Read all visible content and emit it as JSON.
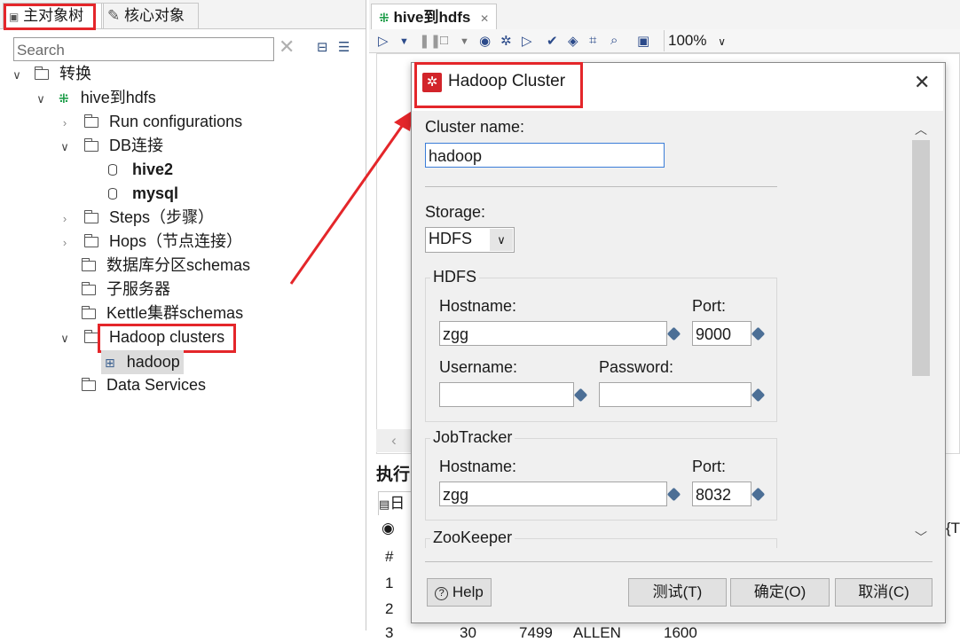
{
  "left_panel": {
    "tabs": [
      {
        "label": "主对象树"
      },
      {
        "label": "核心对象"
      }
    ],
    "search_placeholder": "Search",
    "tree": {
      "root": "转换",
      "transform": "hive到hdfs",
      "run_configs": "Run configurations",
      "db_conn": "DB连接",
      "db_hive2": "hive2",
      "db_mysql": "mysql",
      "steps": "Steps（步骤）",
      "hops": "Hops（节点连接）",
      "partition": "数据库分区schemas",
      "slaves": "子服务器",
      "kettle_cluster": "Kettle集群schemas",
      "hadoop_clusters": "Hadoop clusters",
      "hadoop": "hadoop",
      "data_services": "Data Services"
    }
  },
  "editor": {
    "tab_label": "hive到hdfs",
    "zoom": "100%",
    "bottom_heading": "执行",
    "log_tab": "日",
    "table_header": "#",
    "rows": [
      "1",
      "2",
      "3"
    ],
    "row3_cells": [
      "30",
      "7499",
      "ALLEN",
      "1600"
    ],
    "right_edge": "{T"
  },
  "dialog": {
    "title": "Hadoop Cluster",
    "cluster_name_label": "Cluster name:",
    "cluster_name_value": "hadoop",
    "storage_label": "Storage:",
    "storage_value": "HDFS",
    "hdfs_group": "HDFS",
    "hdfs_hostname_label": "Hostname:",
    "hdfs_hostname_value": "zgg",
    "hdfs_port_label": "Port:",
    "hdfs_port_value": "9000",
    "username_label": "Username:",
    "username_value": "",
    "password_label": "Password:",
    "password_value": "",
    "jobtracker_group": "JobTracker",
    "jt_hostname_label": "Hostname:",
    "jt_hostname_value": "zgg",
    "jt_port_label": "Port:",
    "jt_port_value": "8032",
    "zookeeper_group": "ZooKeeper",
    "help_button": "Help",
    "test_button": "测试(T)",
    "ok_button": "确定(O)",
    "cancel_button": "取消(C)"
  },
  "colors": {
    "highlight": "#e4262a",
    "accent": "#3b7dd8"
  }
}
